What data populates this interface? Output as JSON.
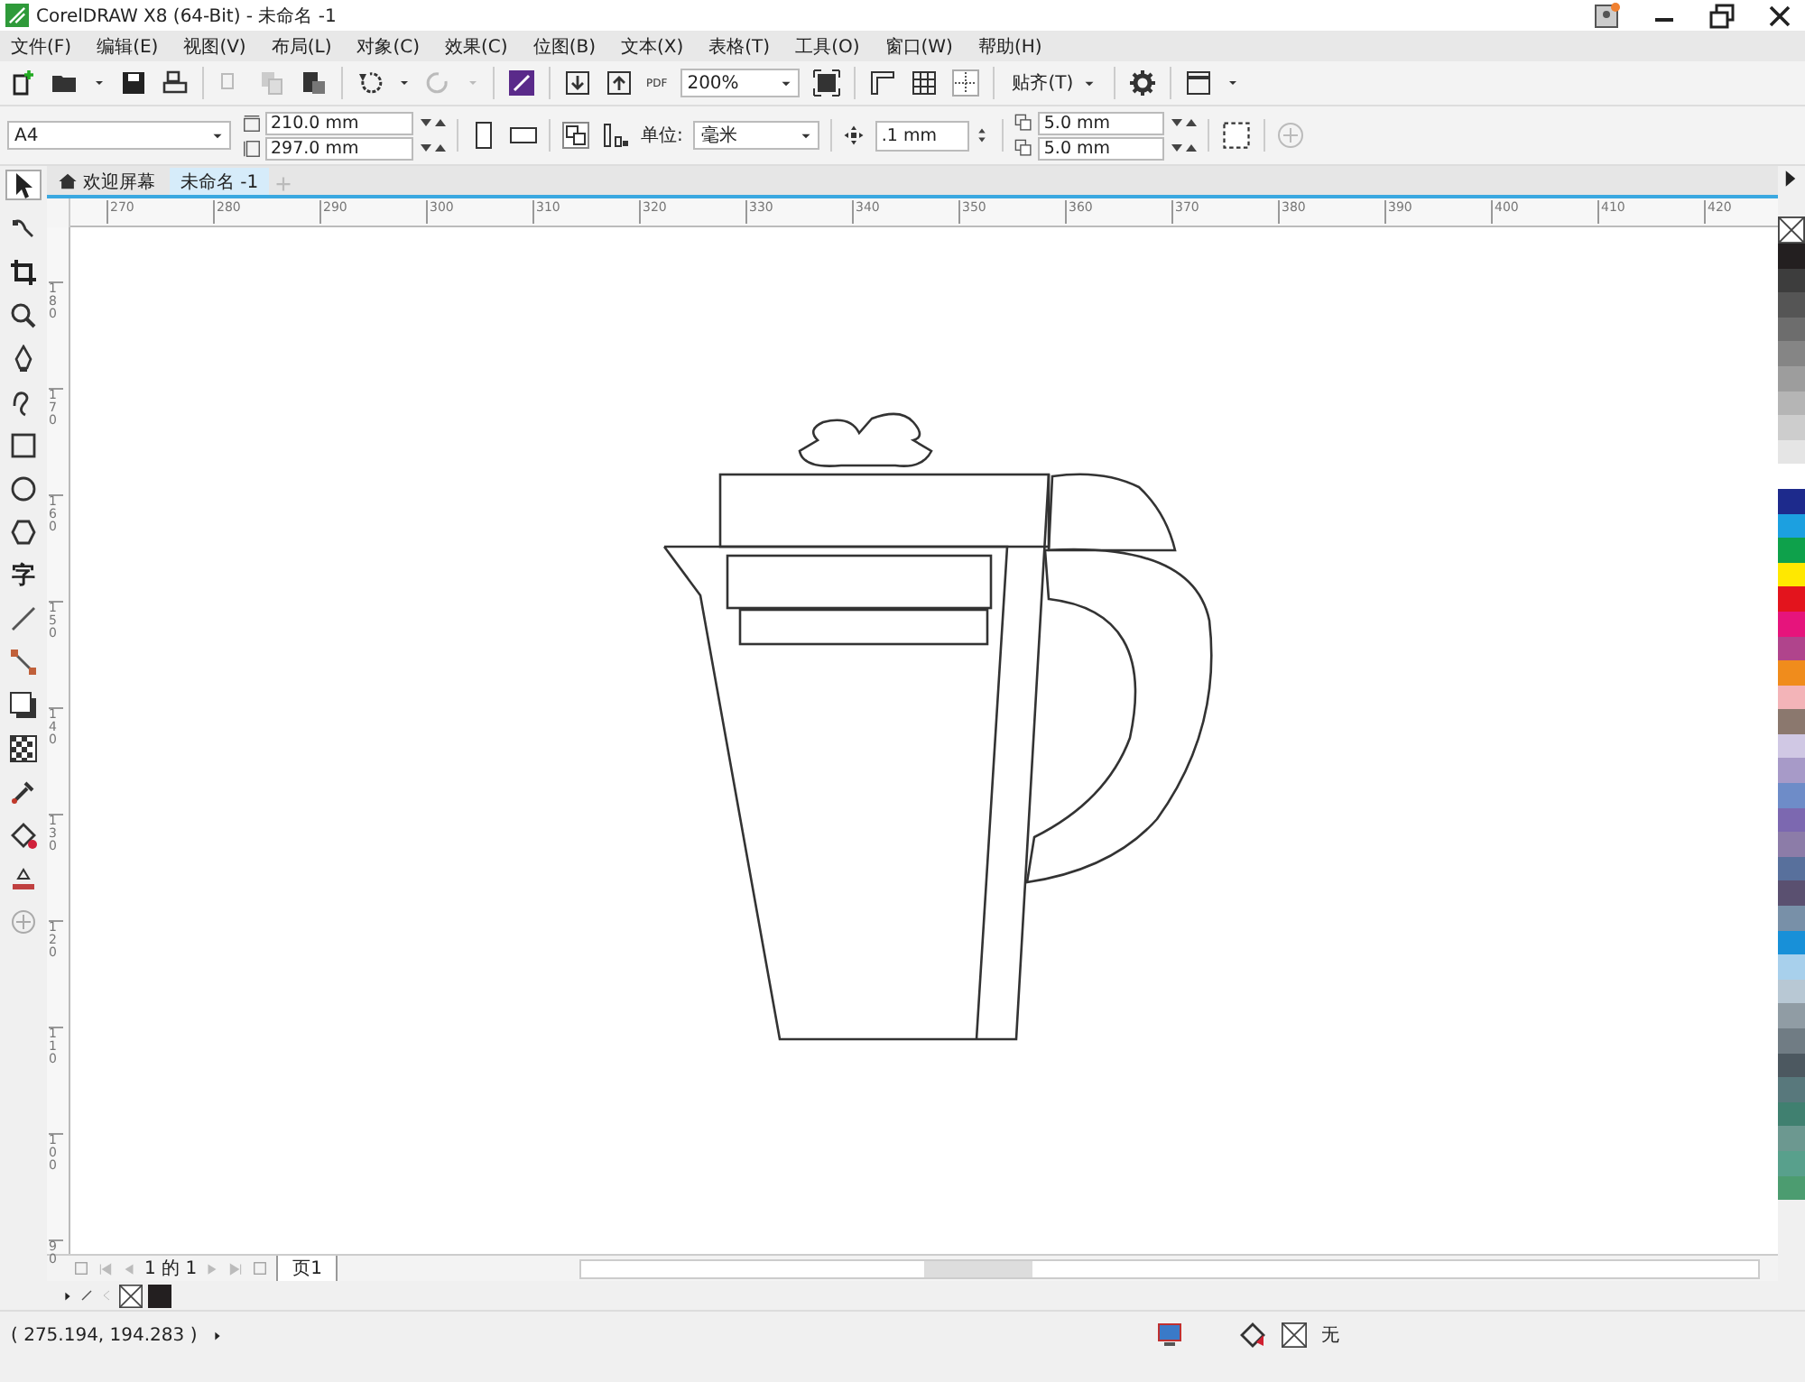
{
  "window": {
    "title": "CorelDRAW X8 (64-Bit) - 未命名 -1"
  },
  "menu": [
    "文件(F)",
    "编辑(E)",
    "视图(V)",
    "布局(L)",
    "对象(C)",
    "效果(C)",
    "位图(B)",
    "文本(X)",
    "表格(T)",
    "工具(O)",
    "窗口(W)",
    "帮助(H)"
  ],
  "toolbar": {
    "pdf_label": "PDF",
    "zoom": "200%",
    "snap": "贴齐(T)"
  },
  "property_bar": {
    "page_size": "A4",
    "width": "210.0 mm",
    "height": "297.0 mm",
    "unit_label": "单位:",
    "unit": "毫米",
    "nudge": ".1 mm",
    "dup_x": "5.0 mm",
    "dup_y": "5.0 mm"
  },
  "doc_tabs": [
    {
      "label": "欢迎屏幕",
      "selected": false
    },
    {
      "label": "未命名 -1",
      "selected": true
    }
  ],
  "tools": [
    {
      "kind": "pick",
      "selected": true
    },
    {
      "kind": "shape",
      "selected": false
    },
    {
      "kind": "crop",
      "selected": false
    },
    {
      "kind": "zoom",
      "selected": false
    },
    {
      "kind": "pen",
      "selected": false
    },
    {
      "kind": "curve",
      "selected": false
    },
    {
      "kind": "rect",
      "selected": false
    },
    {
      "kind": "ellipse",
      "selected": false
    },
    {
      "kind": "polygon",
      "selected": false
    },
    {
      "kind": "text",
      "label": "字",
      "selected": false
    },
    {
      "kind": "line",
      "selected": false
    },
    {
      "kind": "connector",
      "selected": false
    },
    {
      "kind": "shadow",
      "selected": false
    },
    {
      "kind": "transparency",
      "selected": false
    },
    {
      "kind": "eyedropper",
      "selected": false
    },
    {
      "kind": "fill",
      "selected": false
    },
    {
      "kind": "outline",
      "selected": false
    },
    {
      "kind": "add",
      "selected": false
    }
  ],
  "ruler": {
    "horizontal": [
      "270",
      "280",
      "290",
      "300",
      "310",
      "320",
      "330",
      "340",
      "350",
      "360",
      "370",
      "380",
      "390",
      "400",
      "410",
      "420"
    ],
    "vertical": [
      "180",
      "170",
      "160",
      "150",
      "140",
      "130",
      "120",
      "110",
      "100",
      "90"
    ]
  },
  "page_nav": {
    "counter": "1 的 1",
    "page_tab": "页1"
  },
  "palette": [
    {
      "color": "#231f20"
    },
    {
      "color": "#3d3d3d"
    },
    {
      "color": "#555555"
    },
    {
      "color": "#6d6d6d"
    },
    {
      "color": "#858585"
    },
    {
      "color": "#9d9d9d"
    },
    {
      "color": "#b5b5b5"
    },
    {
      "color": "#cdcdcd"
    },
    {
      "color": "#e5e5e5"
    },
    {
      "color": "#ffffff"
    },
    {
      "color": "#1d2a8c"
    },
    {
      "color": "#1ca0e0"
    },
    {
      "color": "#0ea14b"
    },
    {
      "color": "#ffe800"
    },
    {
      "color": "#e3141d"
    },
    {
      "color": "#e6147c"
    },
    {
      "color": "#b0448c"
    },
    {
      "color": "#f08c1c"
    },
    {
      "color": "#f3b4b8"
    },
    {
      "color": "#8b786e"
    },
    {
      "color": "#d0c8e4"
    },
    {
      "color": "#a79ac8"
    },
    {
      "color": "#6e8cc8"
    },
    {
      "color": "#7c68b0"
    },
    {
      "color": "#8c7ca8"
    },
    {
      "color": "#58709c"
    },
    {
      "color": "#5a5070"
    },
    {
      "color": "#7890a8"
    },
    {
      "color": "#1890d8"
    },
    {
      "color": "#a8d0ec"
    },
    {
      "color": "#b8c8d4"
    },
    {
      "color": "#909ca4"
    },
    {
      "color": "#707c84"
    },
    {
      "color": "#4c5860"
    },
    {
      "color": "#58787c"
    },
    {
      "color": "#408070"
    },
    {
      "color": "#6c9890"
    },
    {
      "color": "#58a08c"
    },
    {
      "color": "#4c9c70"
    }
  ],
  "status_bar": {
    "coords": "( 275.194, 194.283 )",
    "fill": "无"
  }
}
